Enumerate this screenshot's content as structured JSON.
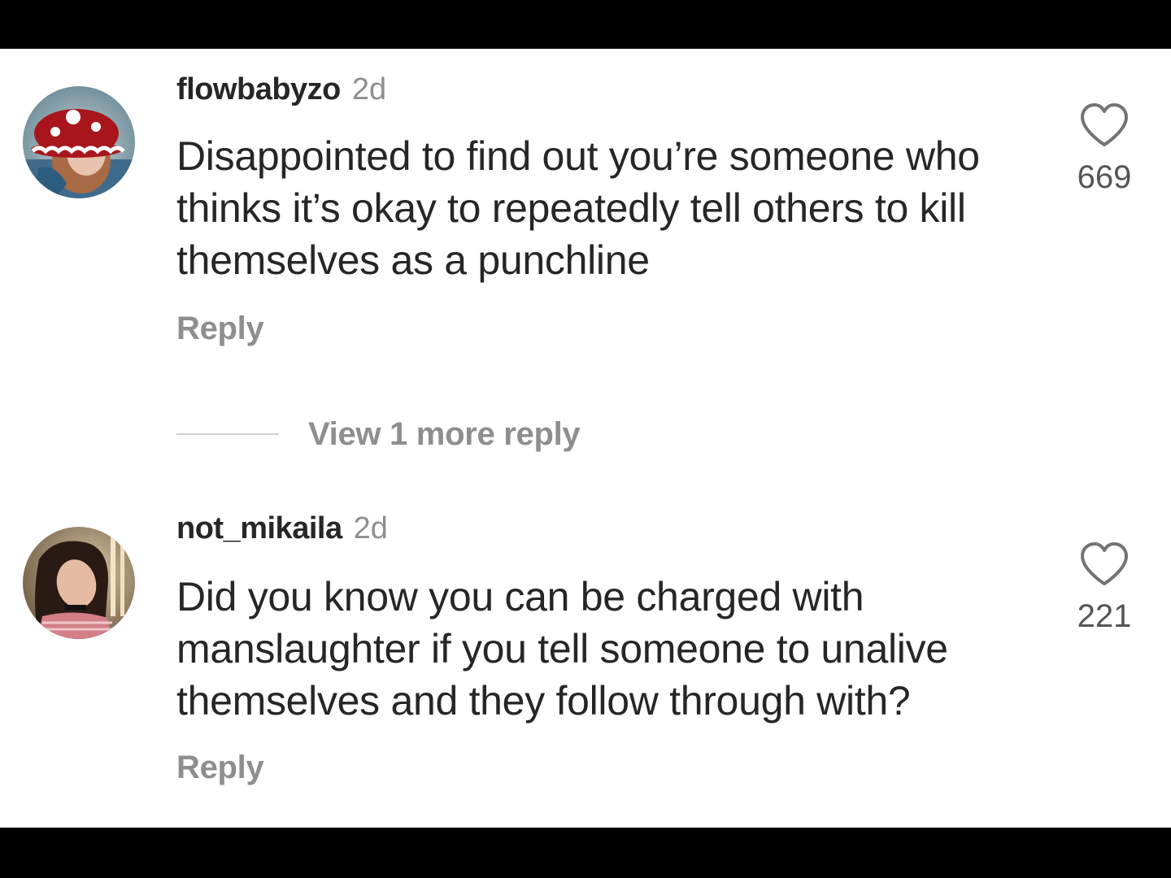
{
  "comments": [
    {
      "username": "flowbabyzo",
      "time": "2d",
      "text": "Disappointed to find out you’re someone who thinks it’s okay to repeatedly tell others to kill themselves as a punchline",
      "reply_label": "Reply",
      "likes": "669",
      "avatar_icon": "profile-photo-red-hat"
    },
    {
      "username": "not_mikaila",
      "time": "2d",
      "text": "Did you know you can be charged with manslaughter if you tell someone to unalive themselves and they follow through with?",
      "reply_label": "Reply",
      "likes": "221",
      "avatar_icon": "profile-photo-dark-hair"
    }
  ],
  "view_more_label": "View 1 more reply",
  "colors": {
    "text": "#262626",
    "secondary": "#8e8e8e",
    "background": "#ffffff",
    "frame": "#000000"
  }
}
